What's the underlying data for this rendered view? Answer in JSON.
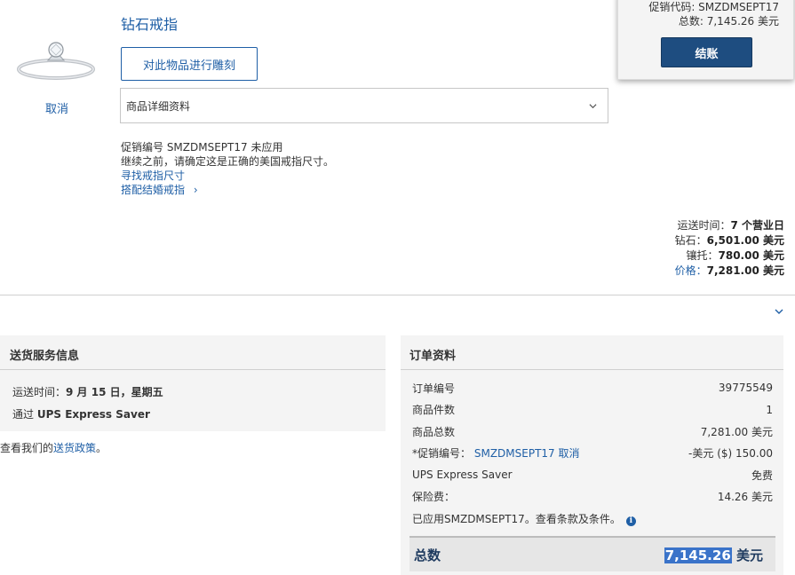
{
  "item": {
    "title": "钻石戒指",
    "engrave_label": "对此物品进行雕刻",
    "cancel_label": "取消",
    "details_select_value": "商品详细资料",
    "promo_not_applied": "促销编号 SMZDMSEPT17 未应用",
    "ring_size_notice": "继续之前，请确定这是正确的美国戒指尺寸。",
    "find_ring_size": "寻找戒指尺寸",
    "match_wedding_ring": "搭配结婚戒指",
    "match_chevron": "›"
  },
  "summary": {
    "promo_code_line": "促销代码: SMZDMSEPT17",
    "total_line": "总数: 7,145.26 美元",
    "checkout_label": "结账"
  },
  "price_lines": {
    "shipping_label": "运送时间：",
    "shipping_value": "7 个营业日",
    "diamond_label": "钻石：",
    "diamond_value": "6,501.00 美元",
    "setting_label": "镶托：",
    "setting_value": "780.00 美元",
    "price_label": "价格：",
    "price_value": "7,281.00 美元"
  },
  "shipping_panel": {
    "title": "送货服务信息",
    "delivery_label": "运送时间：",
    "delivery_value": "9 月 15 日，星期五",
    "via_label": "通过",
    "via_value": "UPS Express Saver",
    "policy_prefix": "查看我们的",
    "policy_link": "送货政策",
    "policy_suffix": "。"
  },
  "order_panel": {
    "title": "订单资料",
    "rows": [
      {
        "label": "订单编号",
        "value": "39775549"
      },
      {
        "label": "商品件数",
        "value": "1"
      },
      {
        "label": "商品总数",
        "value": "7,281.00 美元"
      },
      {
        "label": "*促销编号：",
        "value": "-美元 ($) 150.00"
      },
      {
        "label": "UPS Express Saver",
        "value": "免费"
      },
      {
        "label": "保险费：",
        "value": "14.26 美元"
      }
    ],
    "promo_code": "SMZDMSEPT17",
    "promo_cancel": "取消",
    "applied_note": "已应用SMZDMSEPT17。查看条款及条件。",
    "info_icon_glyph": "i",
    "total_label": "总数",
    "total_number": "7,145.26",
    "total_currency": " 美元"
  },
  "colors": {
    "link": "#1f5fa6",
    "checkout_bg": "#1e4d80",
    "panel_bg": "#f4f4f4"
  }
}
